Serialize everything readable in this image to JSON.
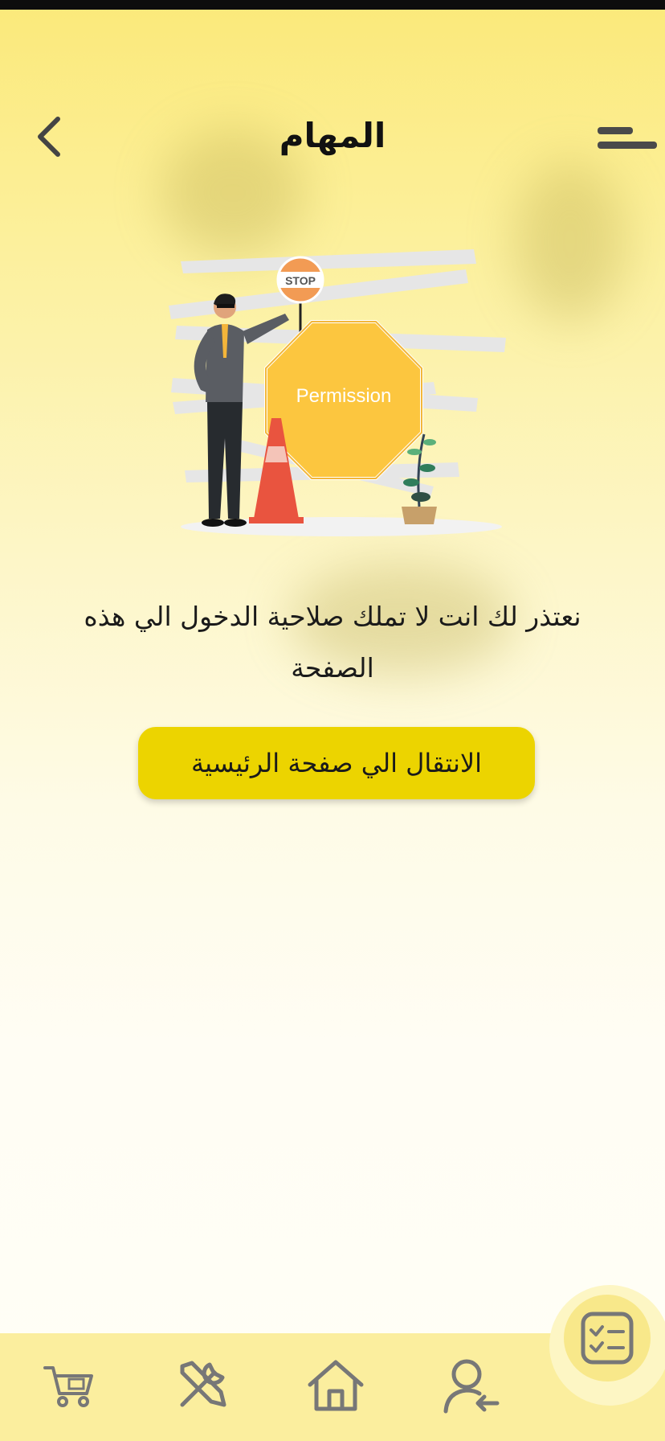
{
  "header": {
    "title": "المهام"
  },
  "illustration": {
    "stop_label": "STOP",
    "sign_label": "Permission"
  },
  "message": {
    "text": "نعتذر لك انت لا تملك صلاحية الدخول الي هذه الصفحة"
  },
  "home_button": {
    "label": "الانتقال الي صفحة الرئيسية"
  },
  "bottom_nav": {
    "items": [
      {
        "icon": "cart-icon"
      },
      {
        "icon": "tools-icon"
      },
      {
        "icon": "home-icon"
      },
      {
        "icon": "user-switch-icon"
      }
    ],
    "fab_icon": "checklist-icon"
  },
  "colors": {
    "accent": "#ecd400",
    "nav_bg": "#fbee9e",
    "sign": "#fcc63f"
  }
}
